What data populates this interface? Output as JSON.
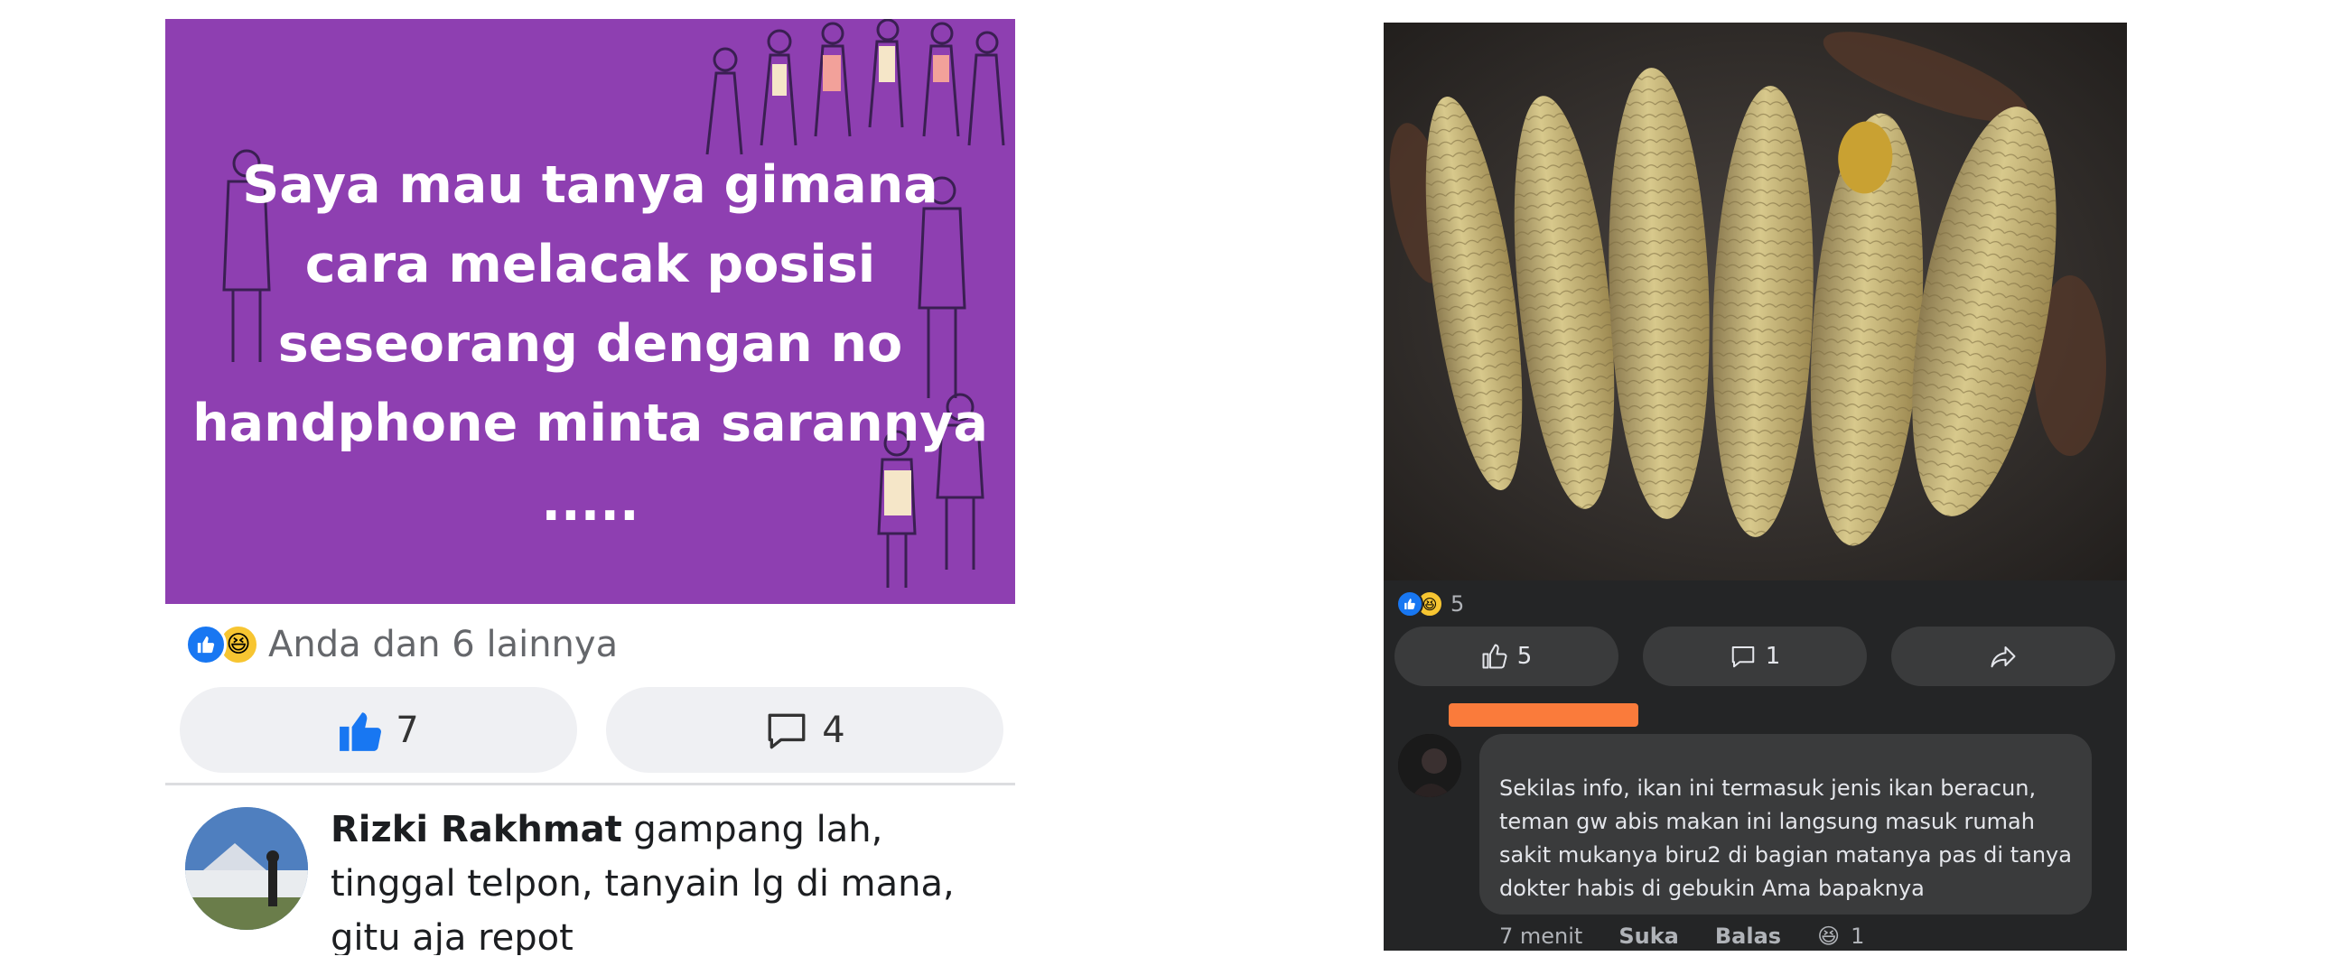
{
  "left_post": {
    "banner_text": "Saya mau tanya gimana cara melacak posisi seseorang dengan no handphone minta sarannya .....",
    "reactions_text": "Anda dan 6 lainnya",
    "like_count": "7",
    "comment_count": "4",
    "comment": {
      "author": "Rizki Rakhmat",
      "text": "gampang lah, tinggal telpon, tanyain lg di mana, gitu aja repot"
    }
  },
  "right_post": {
    "reaction_count": "5",
    "like_count": "5",
    "comment_count": "1",
    "comment": {
      "text": "Sekilas info, ikan ini termasuk jenis ikan beracun, teman gw abis makan ini langsung masuk rumah sakit mukanya biru2 di bagian matanya pas di tanya dokter habis di gebukin Ama bapaknya",
      "time": "7 menit",
      "like_label": "Suka",
      "reply_label": "Balas",
      "reaction_count": "1"
    }
  },
  "icons": [
    "like-icon",
    "haha-icon",
    "thumbs-up-icon",
    "comment-icon",
    "share-icon"
  ],
  "colors": {
    "banner": "#8e3fb1",
    "facebook_blue": "#1877f2",
    "dark_card": "#242526",
    "dark_pill": "#3a3b3c",
    "redaction": "#fa7b3b"
  }
}
